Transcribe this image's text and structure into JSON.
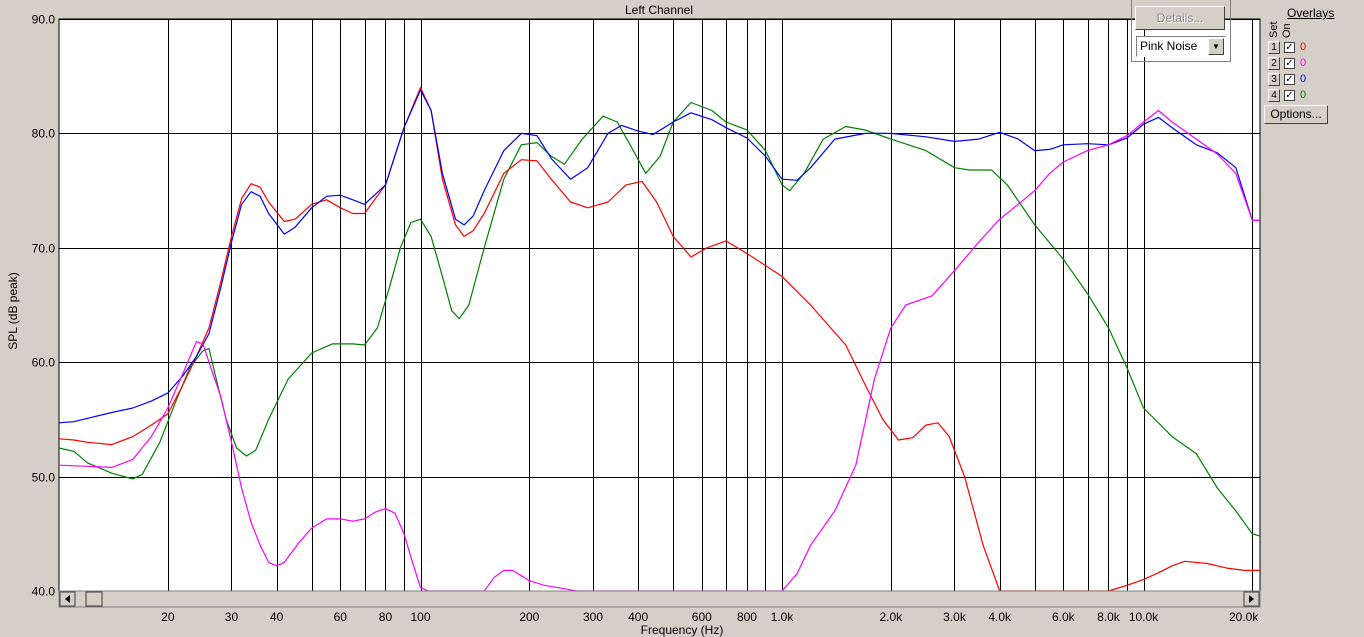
{
  "window": {
    "title": "Left Channel"
  },
  "controls": {
    "details_label": "Details...",
    "signal_select": "Pink Noise",
    "options_label": "Options..."
  },
  "overlays": {
    "title": "Overlays",
    "col_set": "Set",
    "col_on": "On",
    "rows": [
      {
        "set": "1",
        "checked": true,
        "value": "0",
        "color": "#ff0000"
      },
      {
        "set": "2",
        "checked": true,
        "value": "0",
        "color": "#ff00ff"
      },
      {
        "set": "3",
        "checked": true,
        "value": "0",
        "color": "#0000ff"
      },
      {
        "set": "4",
        "checked": true,
        "value": "0",
        "color": "#008000"
      }
    ]
  },
  "chart_data": {
    "type": "line",
    "title": "Left Channel",
    "xlabel": "Frequency (Hz)",
    "ylabel": "SPL (dB peak)",
    "x_scale": "log",
    "xlim": [
      10,
      21000
    ],
    "ylim": [
      40,
      90
    ],
    "y_ticks": [
      "40.0",
      "50.0",
      "60.0",
      "70.0",
      "80.0",
      "90.0"
    ],
    "y_tick_values": [
      40,
      50,
      60,
      70,
      80,
      90
    ],
    "x_tick_labels": [
      {
        "f": 20,
        "label": "20"
      },
      {
        "f": 30,
        "label": "30"
      },
      {
        "f": 40,
        "label": "40"
      },
      {
        "f": 60,
        "label": "60"
      },
      {
        "f": 80,
        "label": "80"
      },
      {
        "f": 100,
        "label": "100"
      },
      {
        "f": 200,
        "label": "200"
      },
      {
        "f": 300,
        "label": "300"
      },
      {
        "f": 400,
        "label": "400"
      },
      {
        "f": 600,
        "label": "600"
      },
      {
        "f": 800,
        "label": "800"
      },
      {
        "f": 1000,
        "label": "1.0k"
      },
      {
        "f": 2000,
        "label": "2.0k"
      },
      {
        "f": 3000,
        "label": "3.0k"
      },
      {
        "f": 4000,
        "label": "4.0k"
      },
      {
        "f": 6000,
        "label": "6.0k"
      },
      {
        "f": 8000,
        "label": "8.0k"
      },
      {
        "f": 10000,
        "label": "10.0k"
      },
      {
        "f": 20000,
        "label": "20.0k"
      }
    ],
    "x_gridlines": [
      20,
      30,
      40,
      50,
      60,
      70,
      80,
      90,
      100,
      200,
      300,
      400,
      500,
      600,
      700,
      800,
      900,
      1000,
      2000,
      3000,
      4000,
      5000,
      6000,
      7000,
      8000,
      9000,
      10000,
      20000
    ],
    "grid": true,
    "series": [
      {
        "color": "#008000",
        "points": [
          [
            10,
            52.5
          ],
          [
            11,
            52.2
          ],
          [
            12,
            51.2
          ],
          [
            14,
            50.3
          ],
          [
            16,
            49.8
          ],
          [
            17,
            50.2
          ],
          [
            19,
            53
          ],
          [
            21,
            56.5
          ],
          [
            23,
            59.5
          ],
          [
            25,
            61
          ],
          [
            26,
            61.2
          ],
          [
            27,
            59
          ],
          [
            29,
            55
          ],
          [
            31,
            52.5
          ],
          [
            33,
            51.8
          ],
          [
            35,
            52.3
          ],
          [
            38,
            55
          ],
          [
            43,
            58.5
          ],
          [
            50,
            60.8
          ],
          [
            57,
            61.6
          ],
          [
            65,
            61.6
          ],
          [
            70,
            61.5
          ],
          [
            76,
            63
          ],
          [
            82,
            66.5
          ],
          [
            88,
            70
          ],
          [
            94,
            72.2
          ],
          [
            100,
            72.5
          ],
          [
            107,
            71
          ],
          [
            115,
            67.5
          ],
          [
            122,
            64.5
          ],
          [
            128,
            63.8
          ],
          [
            136,
            65
          ],
          [
            150,
            70
          ],
          [
            170,
            76
          ],
          [
            190,
            79
          ],
          [
            210,
            79.2
          ],
          [
            230,
            78
          ],
          [
            250,
            77.3
          ],
          [
            280,
            79.5
          ],
          [
            320,
            81.5
          ],
          [
            350,
            81
          ],
          [
            380,
            79
          ],
          [
            420,
            76.5
          ],
          [
            460,
            78
          ],
          [
            500,
            81
          ],
          [
            560,
            82.7
          ],
          [
            640,
            82
          ],
          [
            700,
            81
          ],
          [
            800,
            80.3
          ],
          [
            900,
            78.5
          ],
          [
            1000,
            75.5
          ],
          [
            1050,
            75
          ],
          [
            1150,
            76.5
          ],
          [
            1300,
            79.5
          ],
          [
            1500,
            80.6
          ],
          [
            1700,
            80.3
          ],
          [
            2000,
            79.5
          ],
          [
            2500,
            78.5
          ],
          [
            3000,
            77
          ],
          [
            3300,
            76.8
          ],
          [
            3800,
            76.8
          ],
          [
            4200,
            75.5
          ],
          [
            5000,
            72
          ],
          [
            6000,
            69
          ],
          [
            7000,
            66
          ],
          [
            8000,
            63
          ],
          [
            9000,
            59.5
          ],
          [
            10000,
            56
          ],
          [
            12000,
            53.5
          ],
          [
            14000,
            52
          ],
          [
            16000,
            49
          ],
          [
            18000,
            47
          ],
          [
            20000,
            45
          ],
          [
            21000,
            44.8
          ]
        ]
      },
      {
        "color": "#ff0000",
        "points": [
          [
            10,
            53.3
          ],
          [
            11,
            53.2
          ],
          [
            12,
            53
          ],
          [
            14,
            52.8
          ],
          [
            16,
            53.5
          ],
          [
            18,
            54.5
          ],
          [
            20,
            55.5
          ],
          [
            22,
            58
          ],
          [
            24,
            60.5
          ],
          [
            26,
            63
          ],
          [
            28,
            67
          ],
          [
            30,
            71
          ],
          [
            32,
            74.3
          ],
          [
            34,
            75.6
          ],
          [
            36,
            75.3
          ],
          [
            38,
            74
          ],
          [
            42,
            72.3
          ],
          [
            45,
            72.5
          ],
          [
            50,
            73.8
          ],
          [
            55,
            74.2
          ],
          [
            60,
            73.5
          ],
          [
            65,
            73
          ],
          [
            70,
            73
          ],
          [
            80,
            75.5
          ],
          [
            90,
            80.5
          ],
          [
            100,
            84
          ],
          [
            107,
            82
          ],
          [
            115,
            76
          ],
          [
            125,
            72
          ],
          [
            132,
            71
          ],
          [
            140,
            71.5
          ],
          [
            150,
            73
          ],
          [
            170,
            76.5
          ],
          [
            190,
            77.7
          ],
          [
            210,
            77.6
          ],
          [
            230,
            76
          ],
          [
            260,
            74
          ],
          [
            290,
            73.5
          ],
          [
            330,
            74
          ],
          [
            370,
            75.5
          ],
          [
            410,
            75.8
          ],
          [
            450,
            74
          ],
          [
            500,
            71
          ],
          [
            560,
            69.2
          ],
          [
            620,
            70
          ],
          [
            700,
            70.6
          ],
          [
            800,
            69.5
          ],
          [
            1000,
            67.5
          ],
          [
            1200,
            65
          ],
          [
            1500,
            61.5
          ],
          [
            1700,
            58
          ],
          [
            1900,
            55
          ],
          [
            2100,
            53.2
          ],
          [
            2300,
            53.4
          ],
          [
            2500,
            54.5
          ],
          [
            2700,
            54.7
          ],
          [
            2900,
            53.5
          ],
          [
            3200,
            50
          ],
          [
            3600,
            44
          ],
          [
            4000,
            40
          ],
          [
            6000,
            40
          ],
          [
            8000,
            40
          ],
          [
            9000,
            40.5
          ],
          [
            10000,
            41
          ],
          [
            11000,
            41.6
          ],
          [
            12000,
            42.2
          ],
          [
            13000,
            42.6
          ],
          [
            15000,
            42.4
          ],
          [
            17000,
            42
          ],
          [
            19000,
            41.8
          ],
          [
            21000,
            41.8
          ]
        ]
      },
      {
        "color": "#0000ff",
        "points": [
          [
            10,
            54.7
          ],
          [
            11,
            54.8
          ],
          [
            12,
            55.1
          ],
          [
            14,
            55.6
          ],
          [
            16,
            56
          ],
          [
            18,
            56.6
          ],
          [
            20,
            57.3
          ],
          [
            22,
            58.8
          ],
          [
            24,
            60.5
          ],
          [
            26,
            62.5
          ],
          [
            28,
            66.5
          ],
          [
            30,
            70.5
          ],
          [
            32,
            73.8
          ],
          [
            34,
            74.9
          ],
          [
            36,
            74.5
          ],
          [
            38,
            73
          ],
          [
            42,
            71.2
          ],
          [
            45,
            71.8
          ],
          [
            50,
            73.5
          ],
          [
            55,
            74.5
          ],
          [
            60,
            74.6
          ],
          [
            65,
            74.2
          ],
          [
            70,
            73.8
          ],
          [
            80,
            75.5
          ],
          [
            90,
            80.5
          ],
          [
            100,
            83.8
          ],
          [
            107,
            82
          ],
          [
            115,
            76.5
          ],
          [
            125,
            72.5
          ],
          [
            132,
            72
          ],
          [
            140,
            72.8
          ],
          [
            150,
            75
          ],
          [
            170,
            78.5
          ],
          [
            190,
            80
          ],
          [
            210,
            79.8
          ],
          [
            230,
            77.8
          ],
          [
            260,
            76
          ],
          [
            290,
            77
          ],
          [
            330,
            80
          ],
          [
            360,
            80.7
          ],
          [
            400,
            80.2
          ],
          [
            440,
            79.9
          ],
          [
            500,
            81
          ],
          [
            560,
            81.8
          ],
          [
            640,
            81.2
          ],
          [
            700,
            80.5
          ],
          [
            800,
            79.6
          ],
          [
            900,
            78
          ],
          [
            1000,
            76
          ],
          [
            1100,
            75.9
          ],
          [
            1200,
            77
          ],
          [
            1400,
            79.5
          ],
          [
            1700,
            80
          ],
          [
            2000,
            80
          ],
          [
            2500,
            79.7
          ],
          [
            3000,
            79.3
          ],
          [
            3500,
            79.5
          ],
          [
            4000,
            80.1
          ],
          [
            4500,
            79.5
          ],
          [
            5000,
            78.5
          ],
          [
            5500,
            78.6
          ],
          [
            6000,
            79
          ],
          [
            7000,
            79.1
          ],
          [
            8000,
            79
          ],
          [
            9000,
            79.6
          ],
          [
            10000,
            80.8
          ],
          [
            11000,
            81.4
          ],
          [
            12000,
            80.5
          ],
          [
            14000,
            79
          ],
          [
            16000,
            78.3
          ],
          [
            18000,
            77
          ],
          [
            20000,
            72.4
          ],
          [
            21000,
            72.4
          ]
        ]
      },
      {
        "color": "#ff00ff",
        "points": [
          [
            10,
            51
          ],
          [
            12,
            50.9
          ],
          [
            14,
            50.8
          ],
          [
            16,
            51.5
          ],
          [
            18,
            53.5
          ],
          [
            20,
            56
          ],
          [
            22,
            59
          ],
          [
            24,
            61.8
          ],
          [
            25,
            61.6
          ],
          [
            26,
            60
          ],
          [
            28,
            57
          ],
          [
            30,
            53
          ],
          [
            32,
            49
          ],
          [
            34,
            46
          ],
          [
            36,
            44
          ],
          [
            38,
            42.5
          ],
          [
            40,
            42.2
          ],
          [
            42,
            42.5
          ],
          [
            46,
            44.2
          ],
          [
            50,
            45.5
          ],
          [
            55,
            46.3
          ],
          [
            60,
            46.3
          ],
          [
            65,
            46.1
          ],
          [
            70,
            46.3
          ],
          [
            75,
            46.9
          ],
          [
            80,
            47.2
          ],
          [
            85,
            46.8
          ],
          [
            90,
            45
          ],
          [
            95,
            42.5
          ],
          [
            100,
            40.3
          ],
          [
            105,
            40
          ],
          [
            150,
            40
          ],
          [
            160,
            41.2
          ],
          [
            170,
            41.8
          ],
          [
            180,
            41.8
          ],
          [
            200,
            40.9
          ],
          [
            220,
            40.5
          ],
          [
            250,
            40.2
          ],
          [
            270,
            40
          ],
          [
            1000,
            40
          ],
          [
            1100,
            41.5
          ],
          [
            1200,
            44
          ],
          [
            1400,
            47
          ],
          [
            1600,
            51
          ],
          [
            1800,
            58.5
          ],
          [
            2000,
            63
          ],
          [
            2200,
            65
          ],
          [
            2600,
            65.8
          ],
          [
            3000,
            68
          ],
          [
            3500,
            70.5
          ],
          [
            4000,
            72.5
          ],
          [
            4500,
            73.8
          ],
          [
            5000,
            75
          ],
          [
            5500,
            76.5
          ],
          [
            6000,
            77.5
          ],
          [
            7000,
            78.5
          ],
          [
            8000,
            79
          ],
          [
            9000,
            79.8
          ],
          [
            10000,
            81
          ],
          [
            11000,
            82
          ],
          [
            12000,
            81
          ],
          [
            14000,
            79.5
          ],
          [
            16000,
            78.2
          ],
          [
            18000,
            76.5
          ],
          [
            20000,
            72.4
          ],
          [
            21000,
            72.4
          ]
        ]
      }
    ]
  }
}
